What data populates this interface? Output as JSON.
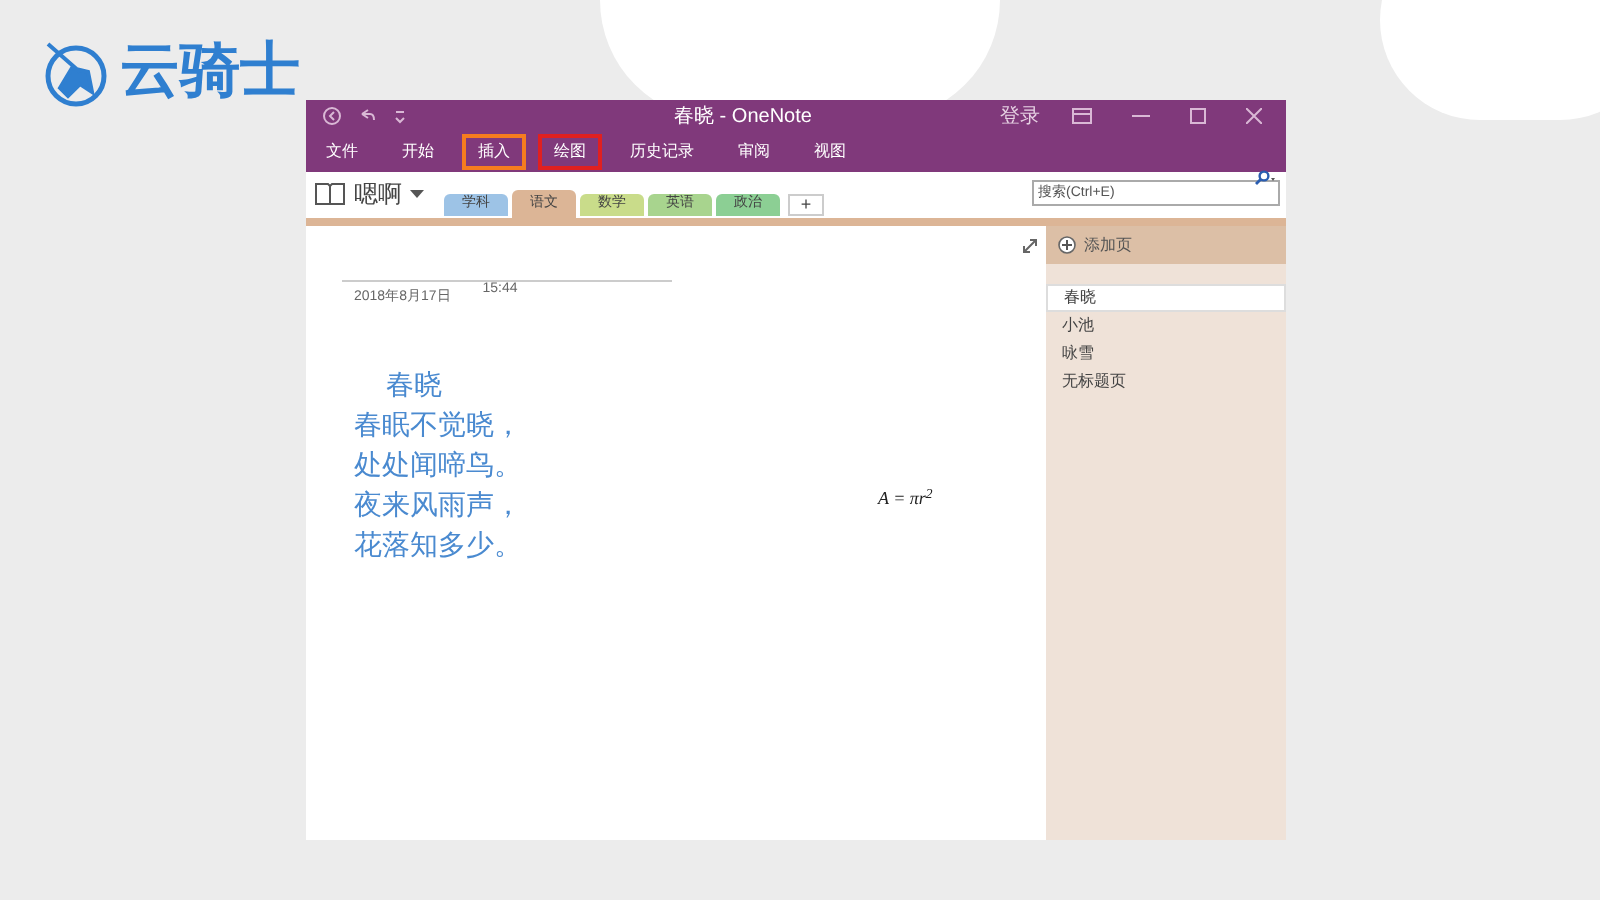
{
  "logo": {
    "text": "云骑士"
  },
  "window": {
    "title": "春晓 - OneNote",
    "sign_in": "登录"
  },
  "ribbon": [
    {
      "label": "文件"
    },
    {
      "label": "开始"
    },
    {
      "label": "插入",
      "color": "#f57c1f"
    },
    {
      "label": "绘图",
      "color": "#e02020"
    },
    {
      "label": "历史记录"
    },
    {
      "label": "审阅"
    },
    {
      "label": "视图"
    }
  ],
  "notebook": {
    "name": "嗯啊"
  },
  "sections": [
    {
      "label": "学科",
      "color": "#9dc3e6",
      "selected": false
    },
    {
      "label": "语文",
      "color": "#dcb596",
      "selected": true
    },
    {
      "label": "数学",
      "color": "#c9dc8a",
      "selected": false
    },
    {
      "label": "英语",
      "color": "#a8d48e",
      "selected": false
    },
    {
      "label": "政治",
      "color": "#8ccf94",
      "selected": false
    }
  ],
  "add_section": "+",
  "search": {
    "placeholder": "搜索(Ctrl+E)"
  },
  "page": {
    "date": "2018年8月17日",
    "time": "15:44",
    "lines": [
      "春晓",
      "春眠不觉晓，",
      "处处闻啼鸟。",
      "夜来风雨声，",
      "花落知多少。"
    ],
    "formula": "A = πr$^{2}$"
  },
  "pages_pane": {
    "add_page": "添加页",
    "pages": [
      {
        "label": "春晓",
        "selected": true
      },
      {
        "label": "小池",
        "selected": false
      },
      {
        "label": "咏雪",
        "selected": false
      },
      {
        "label": "无标题页",
        "selected": false
      }
    ]
  }
}
